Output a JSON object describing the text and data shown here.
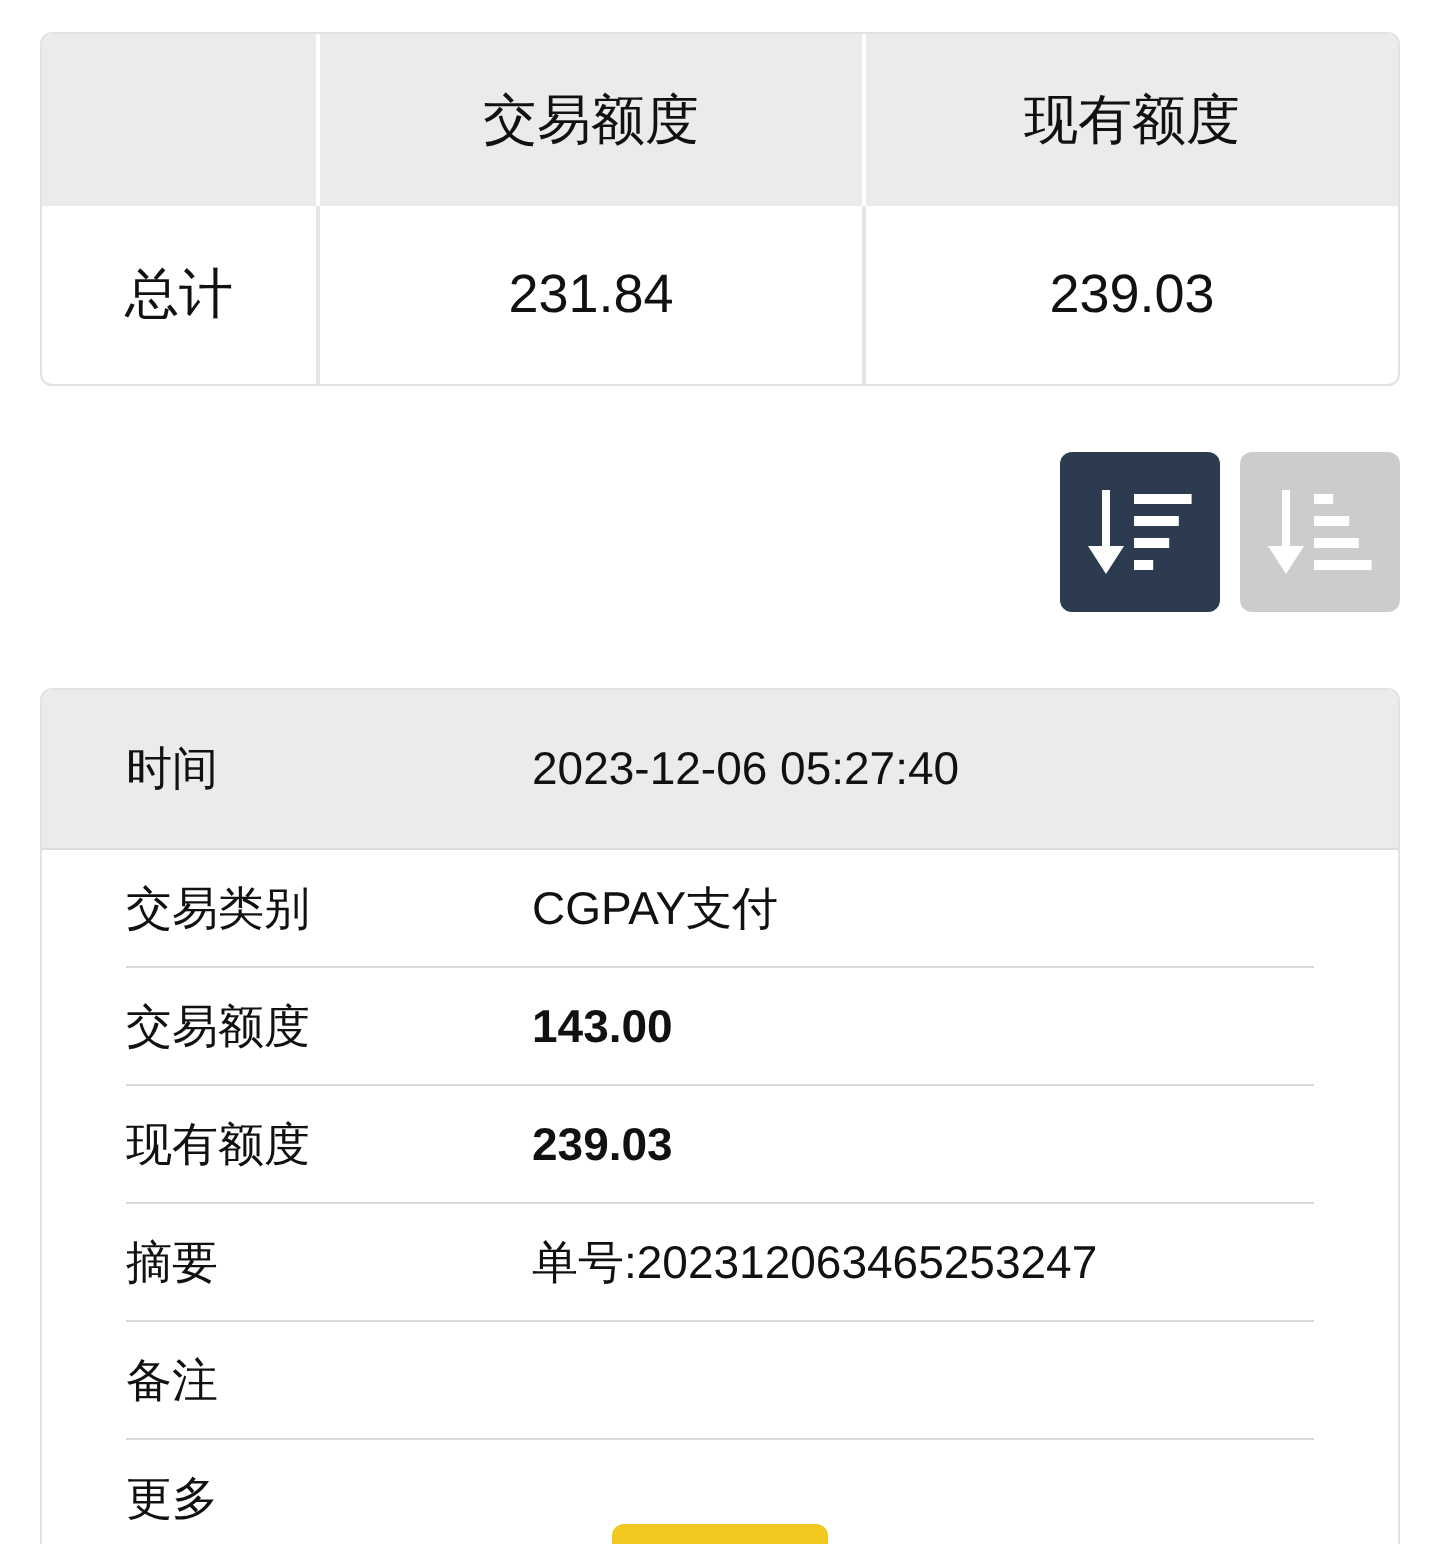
{
  "summary_table": {
    "columns": [
      "",
      "交易额度",
      "现有额度"
    ],
    "rows": [
      {
        "cells": [
          "总计",
          "231.84",
          "239.03"
        ]
      }
    ]
  },
  "sort_buttons": [
    {
      "kind": "descending",
      "selected": true
    },
    {
      "kind": "ascending",
      "selected": false
    }
  ],
  "record": {
    "header": {
      "label": "时间",
      "value": "2023-12-06 05:27:40"
    },
    "rows": [
      {
        "label": "交易类别",
        "value": "CGPAY支付",
        "bold": false
      },
      {
        "label": "交易额度",
        "value": "143.00",
        "bold": true
      },
      {
        "label": "现有额度",
        "value": "239.03",
        "bold": true
      },
      {
        "label": "摘要",
        "value": "单号:202312063465253247",
        "bold": false
      },
      {
        "label": "备注"
      },
      {
        "label": "更多",
        "has_button": true
      }
    ]
  }
}
